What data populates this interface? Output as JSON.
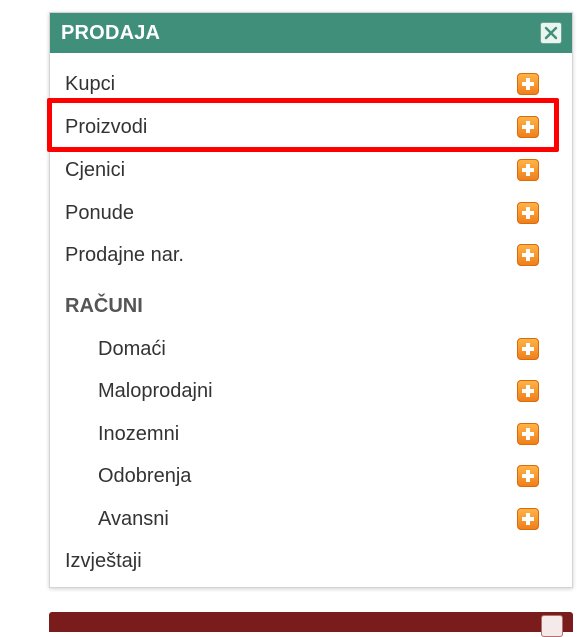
{
  "panel": {
    "title": "PRODAJA",
    "close_icon": "close-x-icon",
    "header_color": "#3f8f7b"
  },
  "menu": {
    "items_top": [
      {
        "label": "Kupci",
        "icon": "add-plus-icon"
      },
      {
        "label": "Proizvodi",
        "icon": "add-plus-icon"
      },
      {
        "label": "Cjenici",
        "icon": "add-plus-icon"
      },
      {
        "label": "Ponude",
        "icon": "add-plus-icon"
      },
      {
        "label": "Prodajne nar.",
        "icon": "add-plus-icon"
      }
    ],
    "section_title": "RAČUNI",
    "section_items": [
      {
        "label": "Domaći",
        "icon": "add-plus-icon"
      },
      {
        "label": "Maloprodajni",
        "icon": "add-plus-icon"
      },
      {
        "label": "Inozemni",
        "icon": "add-plus-icon"
      },
      {
        "label": "Odobrenja",
        "icon": "add-plus-icon"
      },
      {
        "label": "Avansni",
        "icon": "add-plus-icon"
      }
    ],
    "items_bottom": [
      {
        "label": "Izvještaji"
      }
    ]
  },
  "colors": {
    "plus_icon": "#f5921e",
    "highlight": "#ff0000",
    "next_panel_header": "#7a1c1c"
  }
}
